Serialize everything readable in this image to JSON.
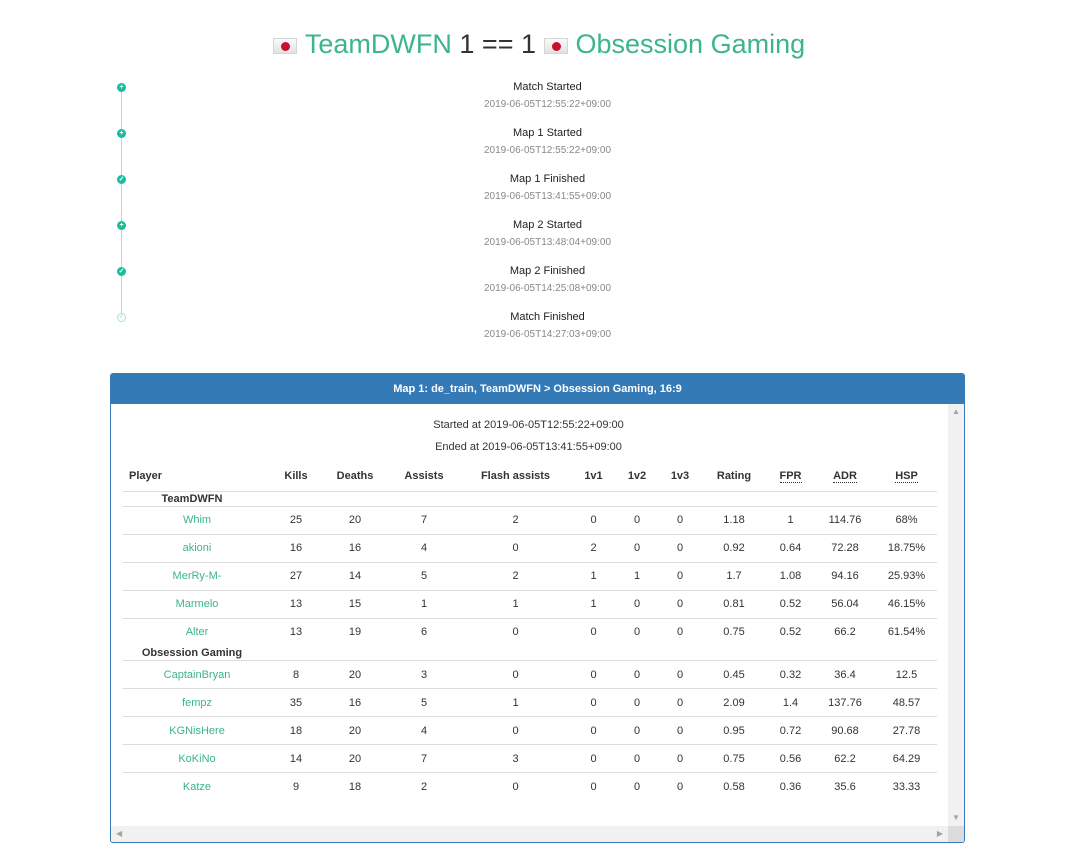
{
  "header": {
    "team1_flag_icon": "japan-flag-icon",
    "team1": "TeamDWFN",
    "score": "1 == 1",
    "team2_flag_icon": "japan-flag-icon",
    "team2": "Obsession Gaming"
  },
  "timeline": [
    {
      "title": "Match Started",
      "time": "2019-06-05T12:55:22+09:00",
      "icon": "plus-circle-icon"
    },
    {
      "title": "Map 1 Started",
      "time": "2019-06-05T12:55:22+09:00",
      "icon": "plus-circle-icon"
    },
    {
      "title": "Map 1 Finished",
      "time": "2019-06-05T13:41:55+09:00",
      "icon": "check-circle-icon"
    },
    {
      "title": "Map 2 Started",
      "time": "2019-06-05T13:48:04+09:00",
      "icon": "plus-circle-icon"
    },
    {
      "title": "Map 2 Finished",
      "time": "2019-06-05T14:25:08+09:00",
      "icon": "check-circle-icon"
    },
    {
      "title": "Match Finished",
      "time": "2019-06-05T14:27:03+09:00",
      "icon": "check-circle-outline-icon"
    }
  ],
  "map_panel": {
    "title": "Map 1: de_train, TeamDWFN > Obsession Gaming, 16:9",
    "started": "Started at 2019-06-05T12:55:22+09:00",
    "ended": "Ended at 2019-06-05T13:41:55+09:00",
    "columns": [
      "Player",
      "Kills",
      "Deaths",
      "Assists",
      "Flash assists",
      "1v1",
      "1v2",
      "1v3",
      "Rating",
      "FPR",
      "ADR",
      "HSP"
    ],
    "teams": [
      {
        "name": "TeamDWFN",
        "players": [
          [
            "Whim",
            "25",
            "20",
            "7",
            "2",
            "0",
            "0",
            "0",
            "1.18",
            "1",
            "114.76",
            "68%"
          ],
          [
            "akioni",
            "16",
            "16",
            "4",
            "0",
            "2",
            "0",
            "0",
            "0.92",
            "0.64",
            "72.28",
            "18.75%"
          ],
          [
            "MerRy-M-",
            "27",
            "14",
            "5",
            "2",
            "1",
            "1",
            "0",
            "1.7",
            "1.08",
            "94.16",
            "25.93%"
          ],
          [
            "Marmelo",
            "13",
            "15",
            "1",
            "1",
            "1",
            "0",
            "0",
            "0.81",
            "0.52",
            "56.04",
            "46.15%"
          ],
          [
            "Alter",
            "13",
            "19",
            "6",
            "0",
            "0",
            "0",
            "0",
            "0.75",
            "0.52",
            "66.2",
            "61.54%"
          ]
        ]
      },
      {
        "name": "Obsession Gaming",
        "players": [
          [
            "CaptainBryan",
            "8",
            "20",
            "3",
            "0",
            "0",
            "0",
            "0",
            "0.45",
            "0.32",
            "36.4",
            "12.5"
          ],
          [
            "fempz",
            "35",
            "16",
            "5",
            "1",
            "0",
            "0",
            "0",
            "2.09",
            "1.4",
            "137.76",
            "48.57"
          ],
          [
            "KGNisHere",
            "18",
            "20",
            "4",
            "0",
            "0",
            "0",
            "0",
            "0.95",
            "0.72",
            "90.68",
            "27.78"
          ],
          [
            "KoKiNo",
            "14",
            "20",
            "7",
            "3",
            "0",
            "0",
            "0",
            "0.75",
            "0.56",
            "62.2",
            "64.29"
          ],
          [
            "Katze",
            "9",
            "18",
            "2",
            "0",
            "0",
            "0",
            "0",
            "0.58",
            "0.36",
            "35.6",
            "33.33"
          ]
        ]
      }
    ]
  },
  "colors": {
    "team_link": "#3cb48c",
    "panel_header": "#337ab7",
    "timeline_dot": "#1abc9c"
  }
}
